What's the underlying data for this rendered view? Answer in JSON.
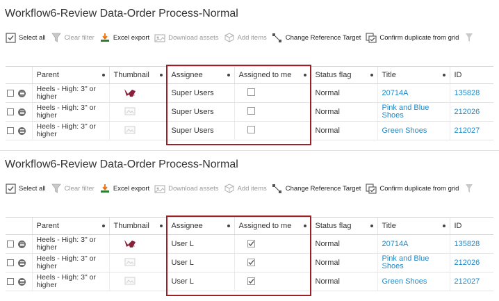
{
  "colors": {
    "link": "#1e88c7",
    "highlight": "#9d1f27",
    "shoe": "#8a1f3a"
  },
  "panels": [
    {
      "title": "Workflow6-Review Data-Order Process-Normal",
      "toolbar": {
        "select_all": "Select all",
        "clear_filter": "Clear filter",
        "excel_export": "Excel export",
        "download_assets": "Download assets",
        "add_items": "Add items",
        "change_reference_target": "Change Reference Target",
        "confirm_duplicate": "Confirm duplicate from grid"
      },
      "columns": {
        "parent": "Parent",
        "thumbnail": "Thumbnail",
        "assignee": "Assignee",
        "assigned_to_me": "Assigned to me",
        "status_flag": "Status flag",
        "title": "Title",
        "id": "ID"
      },
      "rows": [
        {
          "parent": "Heels - High: 3\" or higher",
          "thumbnail": "red-shoe-icon",
          "assignee": "Super Users",
          "assigned_to_me": false,
          "status_flag": "Normal",
          "title": "20714A",
          "id": "135828"
        },
        {
          "parent": "Heels - High: 3\" or higher",
          "thumbnail": "placeholder-image-icon",
          "assignee": "Super Users",
          "assigned_to_me": false,
          "status_flag": "Normal",
          "title": "Pink and Blue Shoes",
          "id": "212026"
        },
        {
          "parent": "Heels - High: 3\" or higher",
          "thumbnail": "placeholder-image-icon",
          "assignee": "Super Users",
          "assigned_to_me": false,
          "status_flag": "Normal",
          "title": "Green Shoes",
          "id": "212027"
        }
      ]
    },
    {
      "title": "Workflow6-Review Data-Order Process-Normal",
      "toolbar": {
        "select_all": "Select all",
        "clear_filter": "Clear filter",
        "excel_export": "Excel export",
        "download_assets": "Download assets",
        "add_items": "Add items",
        "change_reference_target": "Change Reference Target",
        "confirm_duplicate": "Confirm duplicate from grid"
      },
      "columns": {
        "parent": "Parent",
        "thumbnail": "Thumbnail",
        "assignee": "Assignee",
        "assigned_to_me": "Assigned to me",
        "status_flag": "Status flag",
        "title": "Title",
        "id": "ID"
      },
      "rows": [
        {
          "parent": "Heels - High: 3\" or higher",
          "thumbnail": "red-shoe-icon",
          "assignee": "User L",
          "assigned_to_me": true,
          "status_flag": "Normal",
          "title": "20714A",
          "id": "135828"
        },
        {
          "parent": "Heels - High: 3\" or higher",
          "thumbnail": "placeholder-image-icon",
          "assignee": "User L",
          "assigned_to_me": true,
          "status_flag": "Normal",
          "title": "Pink and Blue Shoes",
          "id": "212026"
        },
        {
          "parent": "Heels - High: 3\" or higher",
          "thumbnail": "placeholder-image-icon",
          "assignee": "User L",
          "assigned_to_me": true,
          "status_flag": "Normal",
          "title": "Green Shoes",
          "id": "212027"
        }
      ]
    }
  ]
}
